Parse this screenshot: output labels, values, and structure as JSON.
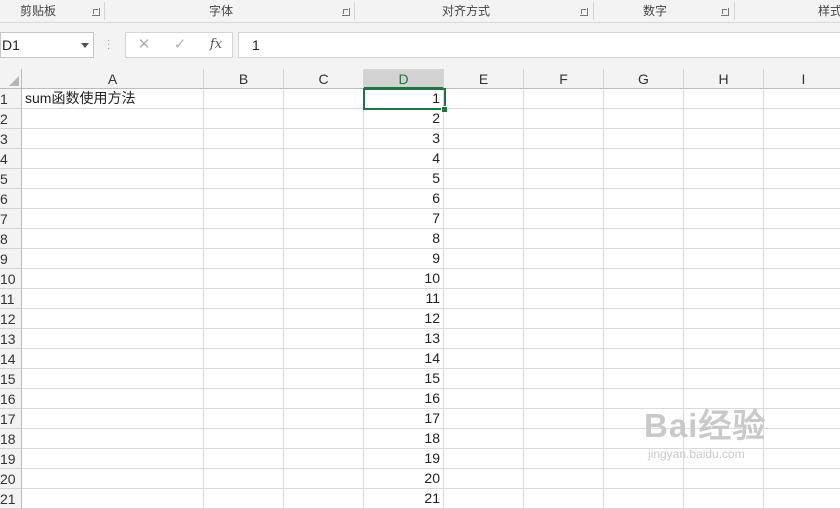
{
  "ribbon": {
    "groups": [
      {
        "label": "剪贴板",
        "center": 38
      },
      {
        "label": "字体",
        "center": 221
      },
      {
        "label": "对齐方式",
        "center": 466
      },
      {
        "label": "数字",
        "center": 655
      },
      {
        "label": "样式",
        "center": 826
      }
    ]
  },
  "formula_bar": {
    "name_box": "D1",
    "cancel_icon": "✕",
    "enter_icon": "✓",
    "fx_label": "fx",
    "content": "1"
  },
  "sheet": {
    "columns": [
      "A",
      "B",
      "C",
      "D",
      "E",
      "F",
      "G",
      "H",
      "I"
    ],
    "selected_column": "D",
    "rows": [
      {
        "n": "1",
        "A": "sum函数使用方法",
        "D": "1"
      },
      {
        "n": "2",
        "D": "2"
      },
      {
        "n": "3",
        "D": "3"
      },
      {
        "n": "4",
        "D": "4"
      },
      {
        "n": "5",
        "D": "5"
      },
      {
        "n": "6",
        "D": "6"
      },
      {
        "n": "7",
        "D": "7"
      },
      {
        "n": "8",
        "D": "8"
      },
      {
        "n": "9",
        "D": "9"
      },
      {
        "n": "10",
        "D": "10"
      },
      {
        "n": "11",
        "D": "11"
      },
      {
        "n": "12",
        "D": "12"
      },
      {
        "n": "13",
        "D": "13"
      },
      {
        "n": "14",
        "D": "14"
      },
      {
        "n": "15",
        "D": "15"
      },
      {
        "n": "16",
        "D": "16"
      },
      {
        "n": "17",
        "D": "17"
      },
      {
        "n": "18",
        "D": "18"
      },
      {
        "n": "19",
        "D": "19"
      },
      {
        "n": "20",
        "D": "20"
      },
      {
        "n": "21",
        "D": "21"
      }
    ]
  },
  "watermark": {
    "brand": "Bai经验",
    "url": "jingyan.baidu.com"
  }
}
